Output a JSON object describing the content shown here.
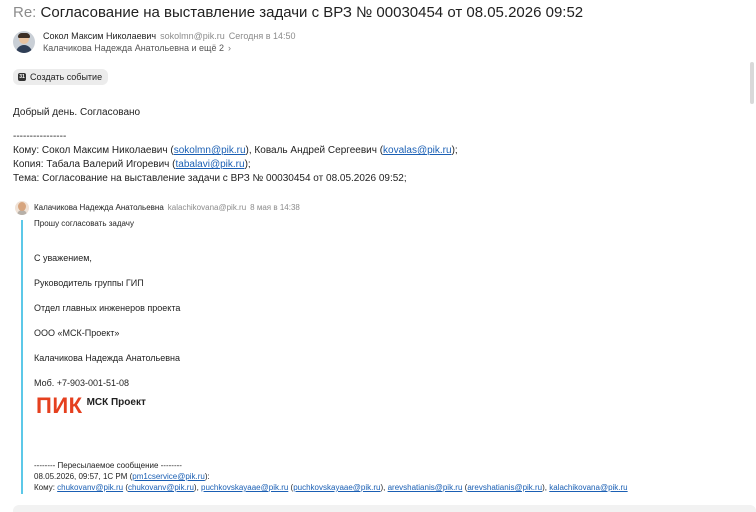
{
  "subject": {
    "prefix": "Re:",
    "text": "Согласование на выставление задачи с ВРЗ № 00030454 от 08.05.2026 09:52"
  },
  "sender": {
    "name": "Сокол Максим Николаевич",
    "email": "sokolmn@pik.ru",
    "time": "Сегодня в 14:50"
  },
  "recipients": {
    "text": "Калачикова Надежда Анатольевна и ещё 2",
    "chevron": "›"
  },
  "create_event": {
    "icon": "31",
    "label": "Создать событие"
  },
  "body": {
    "greeting": "Добрый день. Согласовано",
    "separator": "----------------",
    "to": {
      "label": "Кому: Сокол Максим Николаевич (",
      "email1": "sokolmn@pik.ru",
      "mid": "), Коваль Андрей Сергеевич (",
      "email2": "kovalas@pik.ru",
      "end": ");"
    },
    "cc": {
      "label": "Копия: Табала Валерий Игоревич (",
      "email": "tabalavi@pik.ru",
      "end": ");"
    },
    "subject_line": "Тема: Согласование на выставление задачи с ВРЗ № 00030454 от 08.05.2026 09:52;"
  },
  "quoted": {
    "name": "Калачикова Надежда Анатольевна",
    "email": "kalachikovana@pik.ru",
    "time": "8 мая в 14:38",
    "request": "Прошу согласовать задачу",
    "signature": [
      "С уважением,",
      "Руководитель группы ГИП",
      "Отдел главных инженеров проекта",
      "ООО «МСК-Проект»",
      "Калачикова Надежда Анатольевна",
      "Моб. +7-903-001-51-08"
    ],
    "logo": {
      "pik": "ПИК",
      "msk": "МСК Проект"
    },
    "forwarded": {
      "header": "-------- Пересылаемое сообщение --------",
      "date_prefix": "08.05.2026, 09:57, 1C PM (",
      "date_email": "pm1cservice@pik.ru",
      "date_suffix": "):",
      "to_prefix": "Кому: ",
      "to_items": [
        {
          "a": "chukovanv@pik.ru",
          "b": "chukovanv@pik.ru"
        },
        {
          "a": "puchkovskayaae@pik.ru",
          "b": "puchkovskayaae@pik.ru"
        },
        {
          "a": "arevshatianis@pik.ru",
          "b": "arevshatianis@pik.ru"
        }
      ],
      "to_last": "kalachikovana@pik.ru"
    }
  }
}
